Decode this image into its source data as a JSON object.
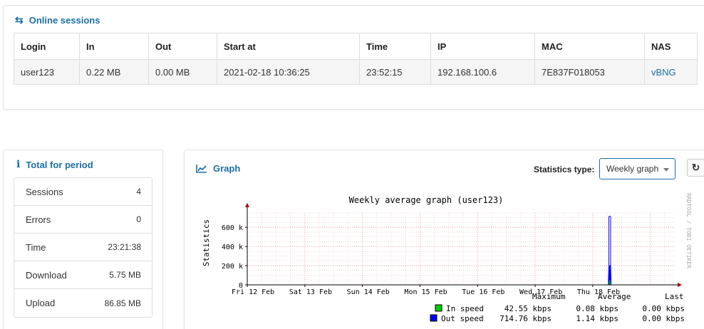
{
  "sessions": {
    "title": "Online sessions",
    "icon": "exchange-icon",
    "columns": [
      "Login",
      "In",
      "Out",
      "Start at",
      "Time",
      "IP",
      "MAC",
      "NAS"
    ],
    "rows": [
      [
        "user123",
        "0.22 MB",
        "0.00 MB",
        "2021-02-18 10:36:25",
        "23:52:15",
        "192.168.100.6",
        "7E837F018053",
        "vBNG"
      ]
    ]
  },
  "totals": {
    "title": "Total for period",
    "icon": "info-icon",
    "items": [
      {
        "label": "Sessions",
        "value": "4"
      },
      {
        "label": "Errors",
        "value": "0"
      },
      {
        "label": "Time",
        "value": "23:21:38"
      },
      {
        "label": "Download",
        "value": "5.75 MB"
      },
      {
        "label": "Upload",
        "value": "86.85 MB"
      }
    ]
  },
  "graph": {
    "title": "Graph",
    "icon": "line-chart-icon",
    "stat_type_label": "Statistics type:",
    "stat_type_value": "Weekly graph",
    "refresh_icon": "refresh-icon",
    "watermark": "RRDTOOL / TOBI OETIKER",
    "legend_headers": {
      "maximum": "Maximum",
      "average": "Average",
      "last": "Last"
    },
    "legend_rows": [
      {
        "name": "In speed",
        "color": "#00cc00",
        "max": "42.55 kbps",
        "avg": "0.08 kbps",
        "last": "0.00 kbps"
      },
      {
        "name": "Out speed",
        "color": "#0000ff",
        "max": "714.76 kbps",
        "avg": "1.14 kbps",
        "last": "0.00 kbps"
      }
    ]
  },
  "chart_data": {
    "type": "area",
    "title": "Weekly average graph (user123)",
    "ylabel": "Statistics",
    "xlabel": "",
    "x_ticks": [
      "Fri 12 Feb",
      "Sat 13 Feb",
      "Sun 14 Feb",
      "Mon 15 Feb",
      "Tue 16 Feb",
      "Wed 17 Feb",
      "Thu 18 Feb"
    ],
    "y_ticks": [
      {
        "value": 0,
        "label": "0"
      },
      {
        "value": 200,
        "label": "200 k"
      },
      {
        "value": 400,
        "label": "400 k"
      },
      {
        "value": 600,
        "label": "600 k"
      }
    ],
    "xlim": [
      0,
      7.4
    ],
    "ylim": [
      0,
      750
    ],
    "grid": true,
    "series": [
      {
        "name": "Out speed",
        "color": "#0000ff",
        "points": [
          [
            6.27,
            0
          ],
          [
            6.28,
            200
          ],
          [
            6.31,
            200
          ],
          [
            6.32,
            0
          ]
        ]
      },
      {
        "name": "In speed",
        "color": "#00cc00",
        "points": [
          [
            6.27,
            0
          ],
          [
            6.28,
            42.55
          ],
          [
            6.31,
            42.55
          ],
          [
            6.32,
            0
          ]
        ]
      }
    ],
    "peak_markers": [
      {
        "x": 6.28,
        "y": 714.76
      },
      {
        "x": 6.31,
        "y": 714.76
      }
    ]
  }
}
